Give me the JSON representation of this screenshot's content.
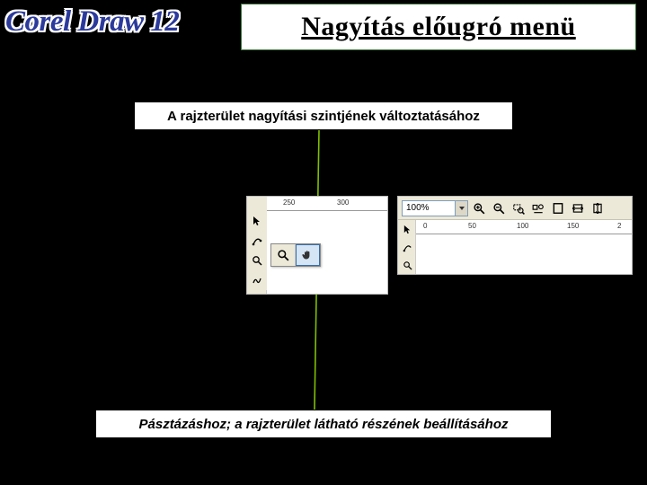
{
  "logo": "Corel Draw 12",
  "title": "Nagyítás előugró menü",
  "caption_top": "A rajzterület nagyítási szintjének változtatásához",
  "caption_bottom": "Pásztázáshoz; a rajzterület látható részének beállításához",
  "left_panel": {
    "ruler_ticks": [
      "250",
      "300"
    ],
    "tools": [
      "pick",
      "shape",
      "zoom",
      "freehand"
    ],
    "flyout": {
      "items": [
        "zoom",
        "hand"
      ],
      "selected_index": 1
    }
  },
  "right_panel": {
    "zoom_value": "100%",
    "toolbar_icons": [
      "zoom-in",
      "zoom-out",
      "zoom-selection",
      "zoom-all-objects",
      "zoom-page",
      "zoom-page-width",
      "zoom-page-height"
    ],
    "ruler_ticks": [
      "0",
      "50",
      "100",
      "150",
      "2"
    ],
    "side_tools": [
      "pick",
      "shape",
      "zoom"
    ]
  },
  "colors": {
    "accent_line": "#7fbf00"
  }
}
